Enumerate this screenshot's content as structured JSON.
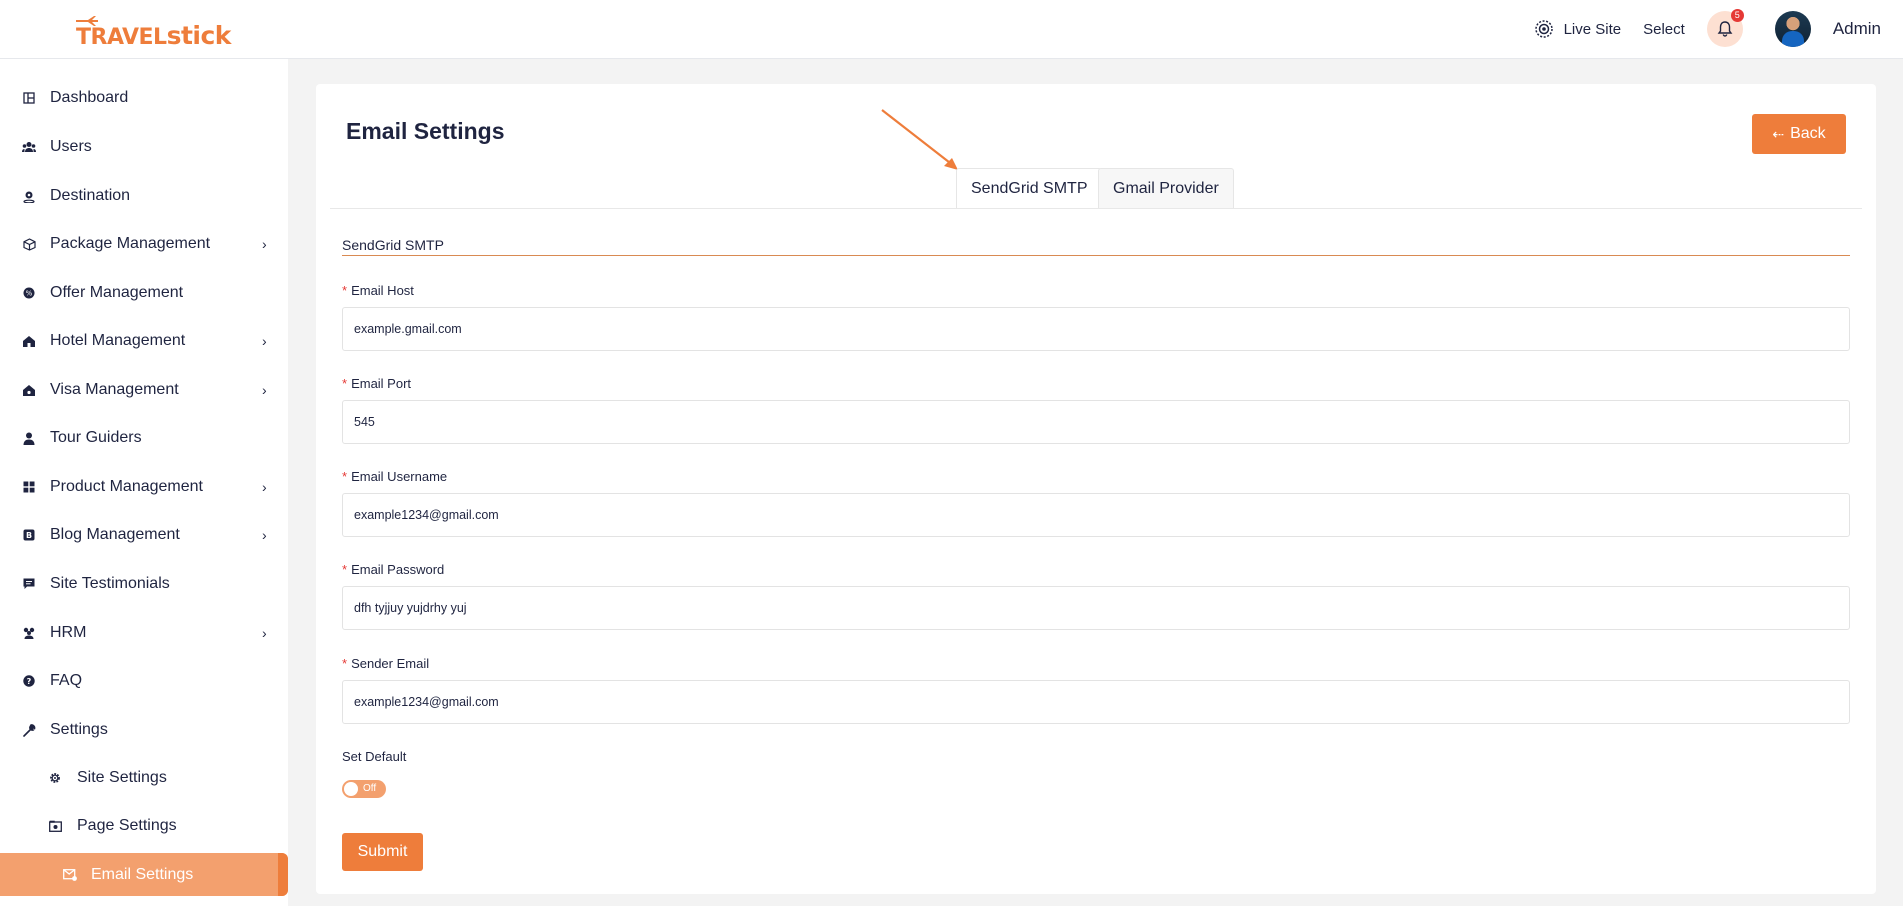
{
  "header": {
    "logo_part1": "TRAVEL",
    "logo_part2": "stick",
    "live_site": "Live Site",
    "select": "Select",
    "notification_count": "5",
    "user_name": "Admin"
  },
  "sidebar": {
    "items": [
      {
        "label": "Dashboard",
        "icon": "dashboard-icon"
      },
      {
        "label": "Users",
        "icon": "users-icon"
      },
      {
        "label": "Destination",
        "icon": "location-pin-icon"
      },
      {
        "label": "Package Management",
        "icon": "cube-icon",
        "chevron": "›"
      },
      {
        "label": "Offer Management",
        "icon": "offer-badge-icon"
      },
      {
        "label": "Hotel Management",
        "icon": "hotel-icon",
        "chevron": "›"
      },
      {
        "label": "Visa Management",
        "icon": "visa-icon",
        "chevron": "›"
      },
      {
        "label": "Tour Guiders",
        "icon": "user-icon"
      },
      {
        "label": "Product Management",
        "icon": "grid-icon",
        "chevron": "›"
      },
      {
        "label": "Blog Management",
        "icon": "blog-icon",
        "chevron": "›"
      },
      {
        "label": "Site Testimonials",
        "icon": "comment-icon"
      },
      {
        "label": "HRM",
        "icon": "team-icon",
        "chevron": "›"
      },
      {
        "label": "FAQ",
        "icon": "question-circle-icon"
      },
      {
        "label": "Settings",
        "icon": "wrench-icon"
      },
      {
        "label": "Site Settings",
        "icon": "gear-icon"
      },
      {
        "label": "Page Settings",
        "icon": "page-icon"
      },
      {
        "label": "Email Settings",
        "icon": "email-settings-icon"
      }
    ]
  },
  "main": {
    "title": "Email Settings",
    "back_label": "Back",
    "tabs": [
      {
        "label": "SendGrid SMTP",
        "active": true
      },
      {
        "label": "Gmail Provider",
        "active": false
      }
    ],
    "section_title": "SendGrid SMTP",
    "fields": [
      {
        "label": "Email Host",
        "required": true,
        "value": "example.gmail.com"
      },
      {
        "label": "Email Port",
        "required": true,
        "value": "545"
      },
      {
        "label": "Email Username",
        "required": true,
        "value": "example1234@gmail.com"
      },
      {
        "label": "Email Password",
        "required": false,
        "value": "dfh tyjjuy yujdrhy yuj"
      },
      {
        "label": "Sender Email",
        "required": true,
        "value": "example1234@gmail.com"
      }
    ],
    "set_default_label": "Set Default",
    "toggle_text": "Off",
    "submit_label": "Submit"
  },
  "colors": {
    "accent": "#ee7d3b",
    "accent_light": "#f3a06e",
    "text": "#1f2440"
  }
}
